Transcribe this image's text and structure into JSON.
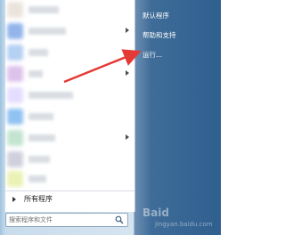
{
  "start_menu": {
    "left_items": [
      {
        "icon": "blurred-app-icon",
        "color": "#e8e0d8",
        "has_submenu": false
      },
      {
        "icon": "blurred-app-icon",
        "color": "#7fa8e8",
        "has_submenu": true
      },
      {
        "icon": "blurred-app-icon",
        "color": "#a8c8f0",
        "has_submenu": false
      },
      {
        "icon": "blurred-app-icon",
        "color": "#d8b8e8",
        "has_submenu": true
      },
      {
        "icon": "blurred-app-icon",
        "color": "#e0d8ff",
        "has_submenu": false
      },
      {
        "icon": "blurred-app-icon",
        "color": "#7db8f0",
        "has_submenu": false
      },
      {
        "icon": "blurred-app-icon",
        "color": "#b8e0c8",
        "has_submenu": false
      },
      {
        "icon": "blurred-app-icon",
        "color": "#c8c8d8",
        "has_submenu": true
      },
      {
        "icon": "blurred-app-icon",
        "color": "#e8f0a8",
        "has_submenu": false
      },
      {
        "icon": "blurred-app-icon",
        "color": "#b8d8e8",
        "has_submenu": false
      }
    ],
    "all_programs_label": "所有程序",
    "search_placeholder": "搜索程序和文件",
    "right_items": [
      {
        "label": "默认程序"
      },
      {
        "label": "帮助和支持"
      },
      {
        "label": "运行..."
      }
    ]
  },
  "watermark": {
    "text": "Baid",
    "sub": "jingyan.baidu.com"
  },
  "colors": {
    "arrow": "#e53935",
    "right_panel_text": "#ffffff"
  }
}
